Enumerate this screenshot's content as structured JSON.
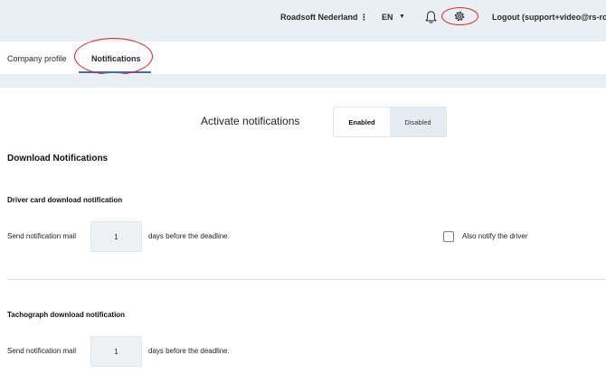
{
  "header": {
    "org_name": "Roadsoft Nederland",
    "kebab": "⋮",
    "language": "EN",
    "language_caret": "▼",
    "logout": "Logout (support+video@rs-roa"
  },
  "icons": {
    "notifications": "bell-icon",
    "settings": "gear-icon",
    "language_menu": "chevron-down-icon",
    "more": "kebab-icon"
  },
  "tabs": [
    {
      "label": "Company profile",
      "active": false
    },
    {
      "label": "Notifications",
      "active": true
    }
  ],
  "activate": {
    "label": "Activate notifications",
    "enabled_label": "Enabled",
    "disabled_label": "Disabled",
    "selected": "Enabled"
  },
  "download_section": {
    "title": "Download Notifications"
  },
  "driver_card": {
    "title": "Driver card download notification",
    "send_label": "Send notification mail",
    "days": "1",
    "suffix": "days before the deadline.",
    "also_notify_label": "Also notify the driver",
    "also_notify_checked": false
  },
  "tachograph": {
    "title": "Tachograph download notification",
    "send_label": "Send notification mail",
    "days": "1",
    "suffix": "days before the deadline."
  },
  "colors": {
    "header_bg": "#e9eff3",
    "annotation": "#e02020",
    "active_tab_underline": "#3b6fc4",
    "disabled_segment_bg": "#e4ebf1"
  }
}
